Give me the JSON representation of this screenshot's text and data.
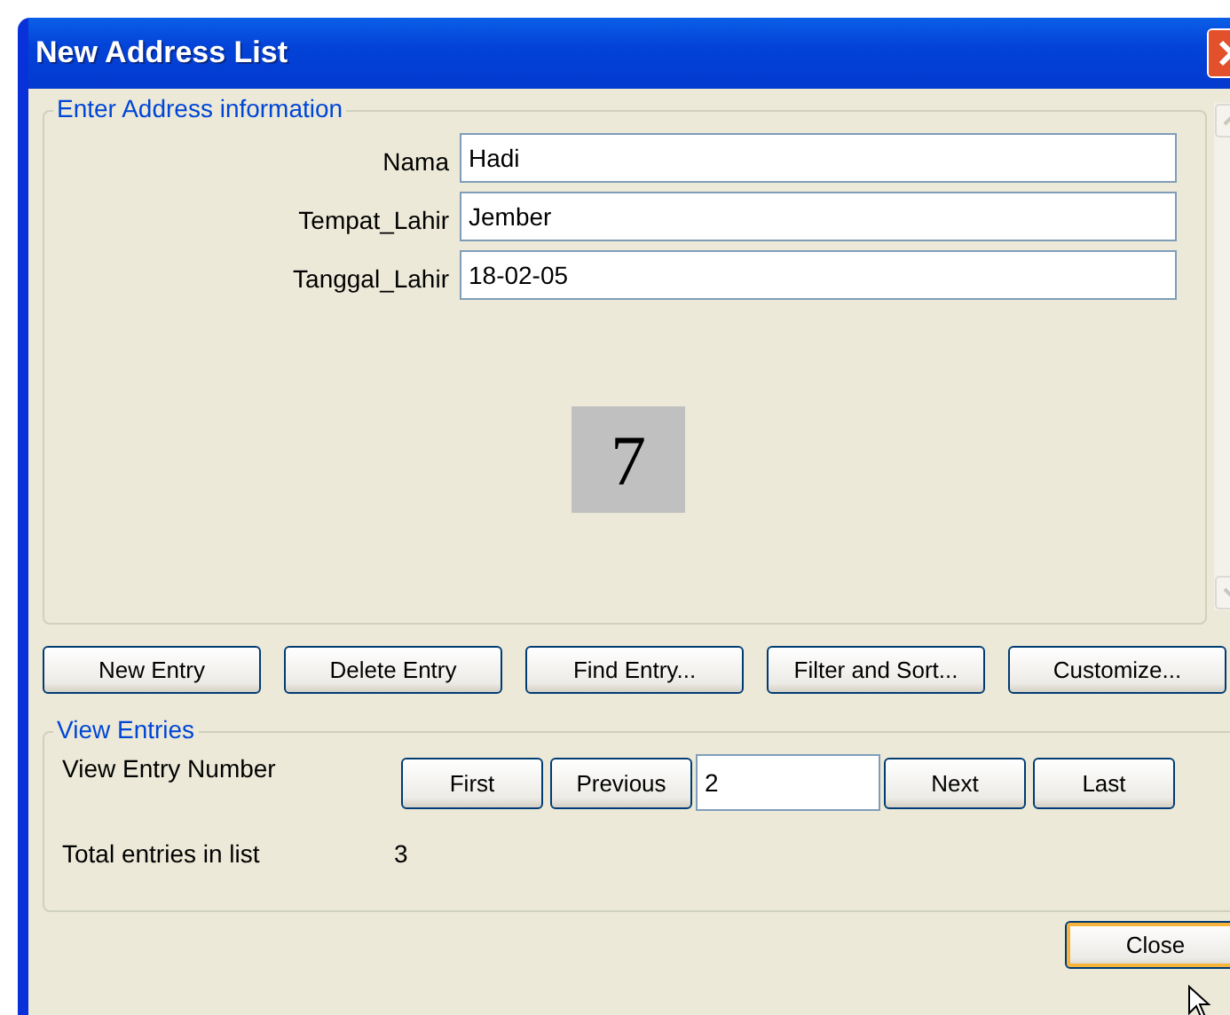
{
  "window": {
    "title": "New Address List"
  },
  "address_group": {
    "title": "Enter Address information",
    "fields": [
      {
        "label": "Nama",
        "value": "Hadi"
      },
      {
        "label": "Tempat_Lahir",
        "value": "Jember"
      },
      {
        "label": "Tanggal_Lahir",
        "value": "18-02-05"
      }
    ],
    "badge": "7"
  },
  "actions": [
    "New Entry",
    "Delete Entry",
    "Find Entry...",
    "Filter and Sort...",
    "Customize..."
  ],
  "view_group": {
    "title": "View Entries",
    "entry_label": "View Entry Number",
    "buttons_before": [
      "First",
      "Previous"
    ],
    "entry_value": "2",
    "buttons_after": [
      "Next",
      "Last"
    ],
    "total_label": "Total entries in list",
    "total_value": "3"
  },
  "buttons": [
    {
      "label": "Close",
      "default": true
    }
  ]
}
